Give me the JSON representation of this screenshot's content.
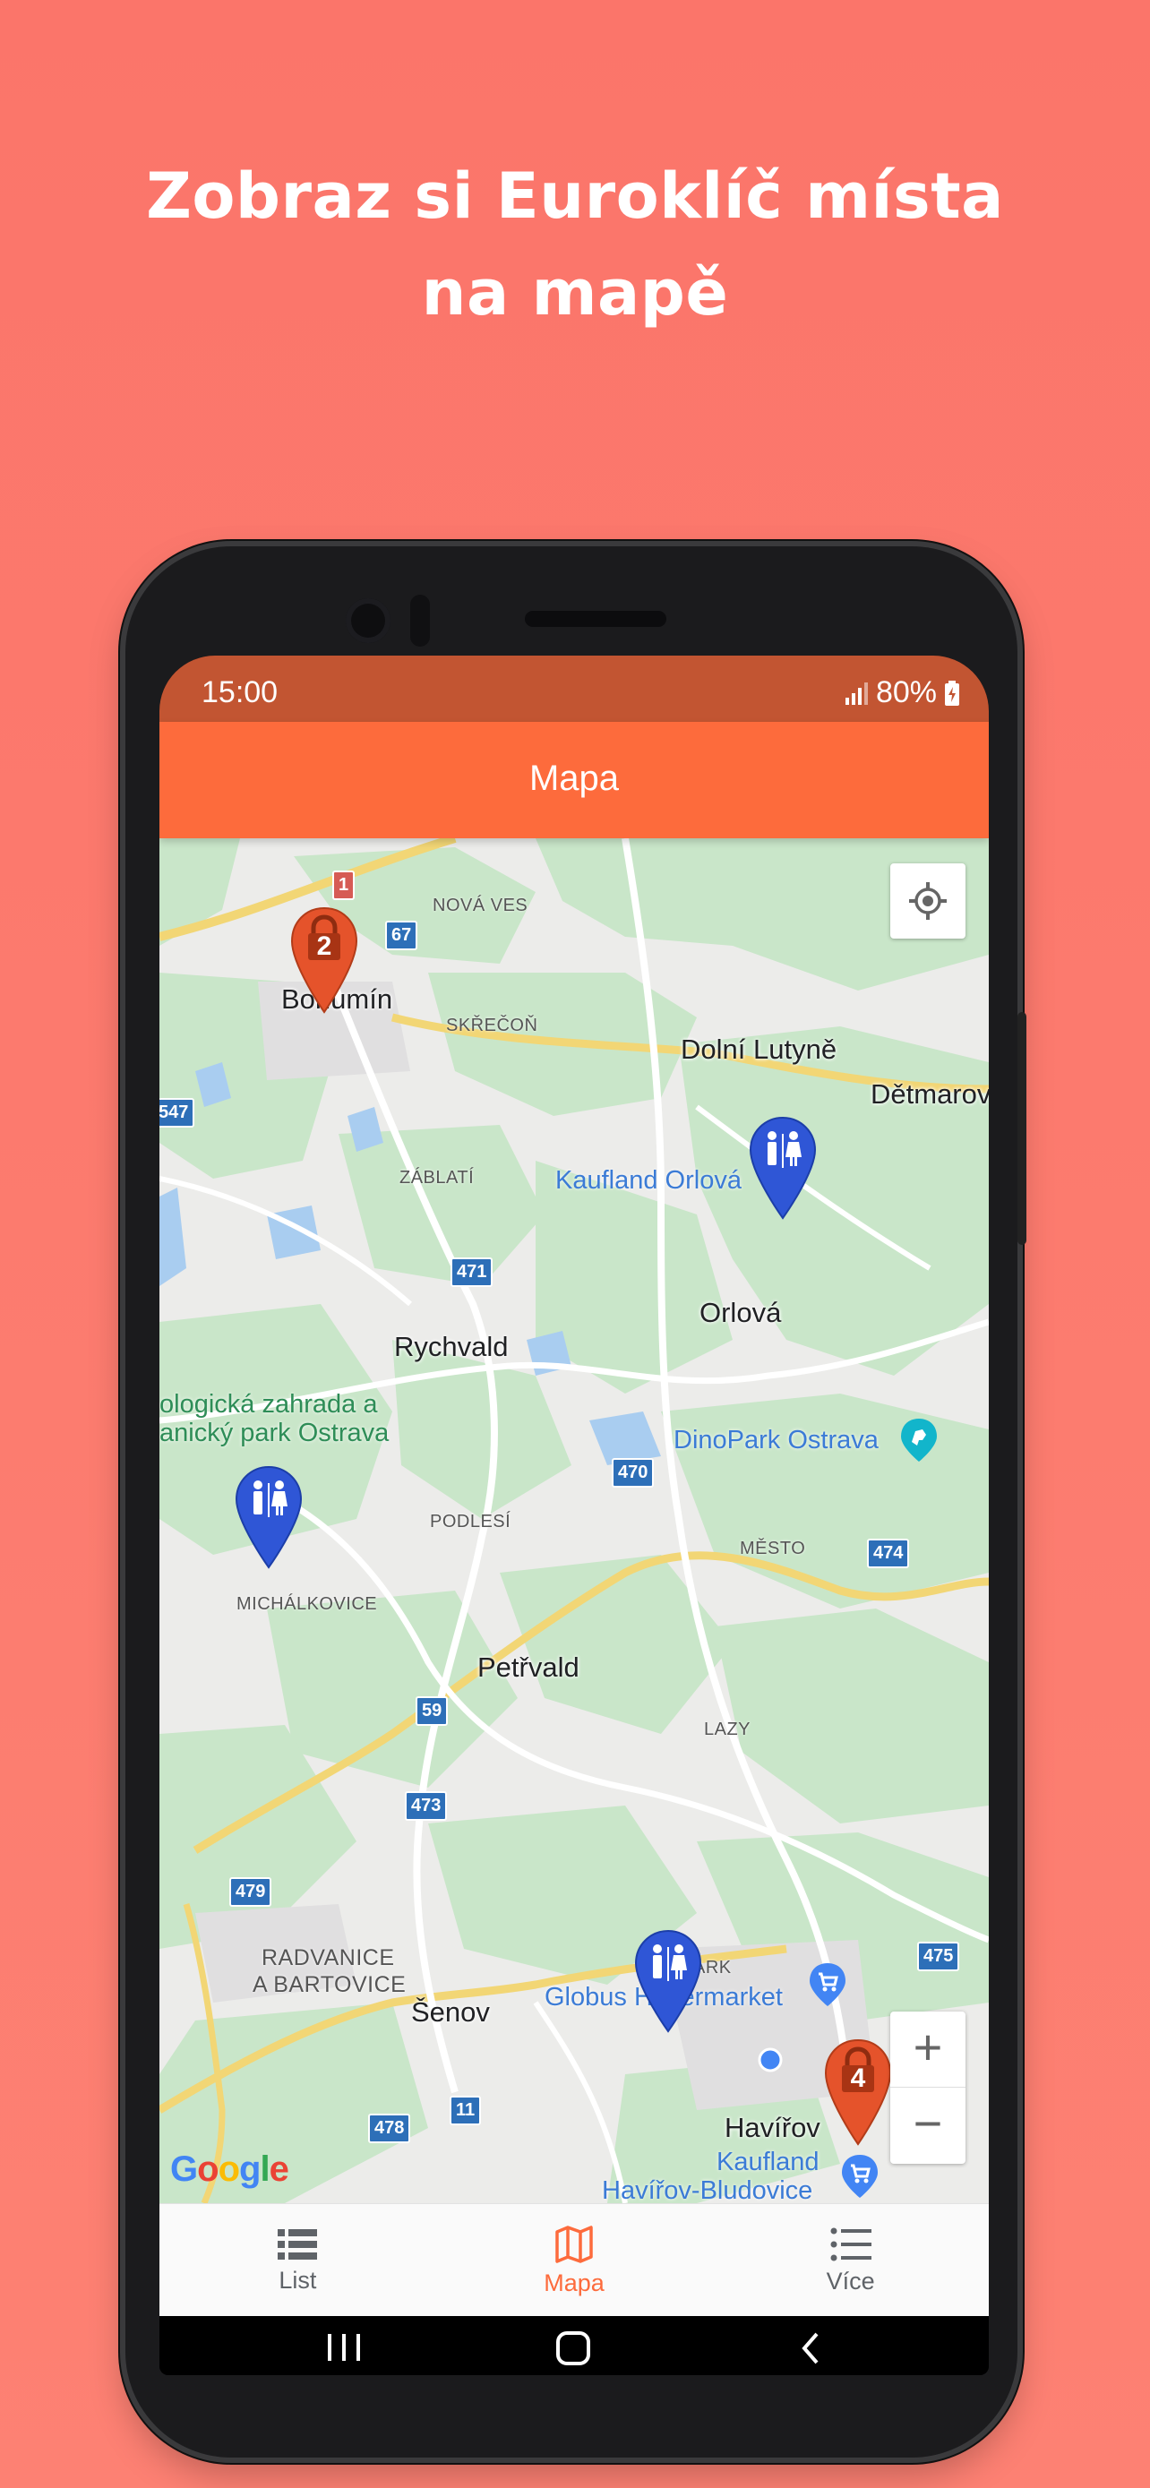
{
  "headline": {
    "line1": "Zobraz si Euroklíč místa",
    "line2": "na mapě"
  },
  "status_bar": {
    "time": "15:00",
    "battery": "80%"
  },
  "app_bar": {
    "title": "Mapa"
  },
  "map": {
    "towns": {
      "bohumin": "Bohumín",
      "dolni_lutyne": "Dolní Lutyně",
      "detmarov": "Dětmarov",
      "orlova": "Orlová",
      "rychvald": "Rychvald",
      "petrvald": "Petřvald",
      "senov": "Šenov",
      "havirov": "Havířov"
    },
    "districts": {
      "nova_ves": "NOVÁ VES",
      "skrecon": "SKŘEČOŇ",
      "zablati": "ZÁBLATÍ",
      "podlesi": "PODLESÍ",
      "mesto": "MĚSTO",
      "michalkovice": "MICHÁLKOVICE",
      "lazy": "LAZY",
      "radvanice_1": "RADVANICE",
      "radvanice_2": "A BARTOVICE",
      "park": "ARK"
    },
    "pois": {
      "zoo_1": "ologická zahrada a",
      "zoo_2": "anický park Ostrava",
      "kaufland_orlova": "Kaufland Orlová",
      "dinopark": "DinoPark Ostrava",
      "globus": "Globus Hypermarket",
      "kaufland_havirov_1": "Kaufland",
      "kaufland_havirov_2": "Havířov-Bludovice"
    },
    "road_shields": {
      "r1": "1",
      "r67": "67",
      "r547": "547",
      "r471": "471",
      "r470": "470",
      "r474": "474",
      "r59": "59",
      "r473": "473",
      "r479": "479",
      "r478": "478",
      "r11": "11",
      "r475": "475"
    },
    "clusters": {
      "bohumin_count": "2",
      "havirov_count": "4"
    },
    "controls": {
      "zoom_in": "+",
      "zoom_out": "−"
    },
    "attribution": {
      "g1": "G",
      "o1": "o",
      "o2": "o",
      "g2": "g",
      "l": "l",
      "e": "e"
    }
  },
  "bottom_nav": {
    "list": "List",
    "map": "Mapa",
    "more": "Více"
  },
  "colors": {
    "background": "#fb756a",
    "status_bar": "#c25532",
    "app_bar": "#fd6b3c",
    "accent": "#fd6b3c",
    "lock_marker": "#e5532b",
    "toilet_marker": "#2f56d6"
  }
}
